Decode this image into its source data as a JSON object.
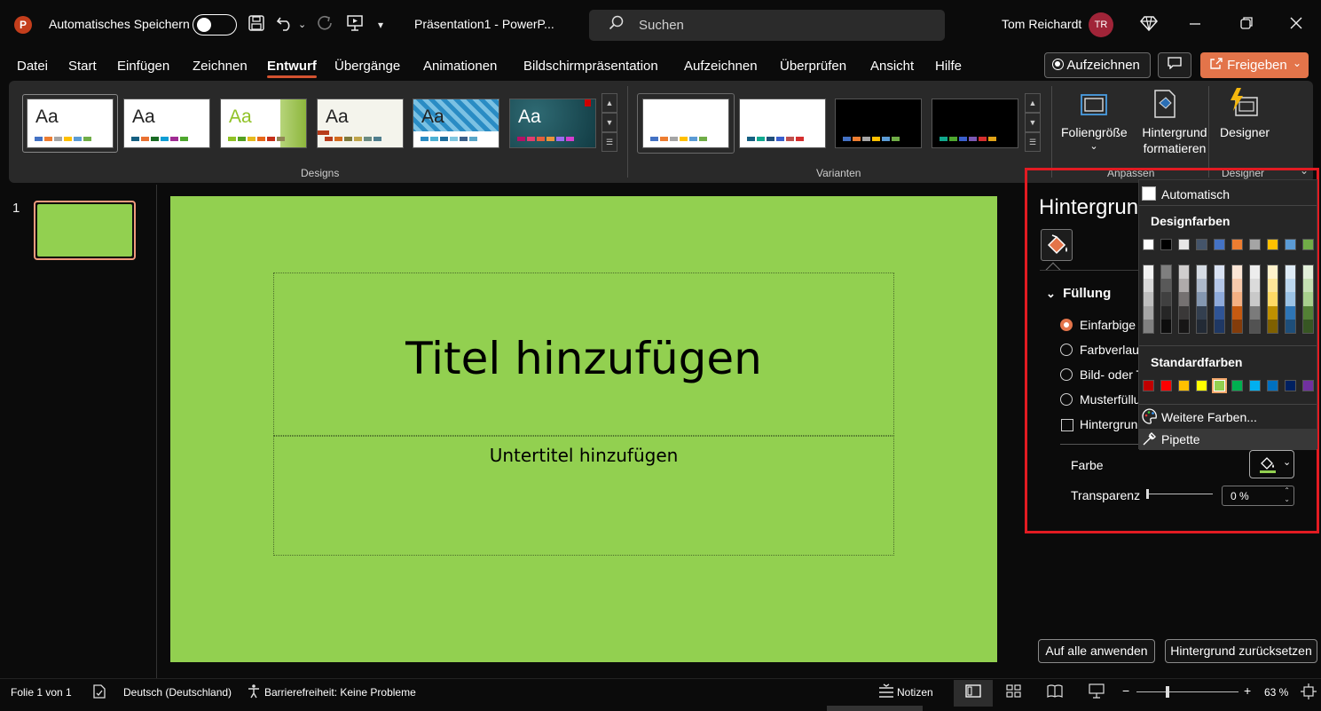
{
  "titlebar": {
    "app_icon": "P",
    "autosave_label": "Automatisches Speichern",
    "doc_title": "Präsentation1  -  PowerP...",
    "search_placeholder": "Suchen",
    "user_name": "Tom Reichardt",
    "user_initials": "TR"
  },
  "menu": {
    "items": [
      "Datei",
      "Start",
      "Einfügen",
      "Zeichnen",
      "Entwurf",
      "Übergänge",
      "Animationen",
      "Bildschirmpräsentation",
      "Aufzeichnen",
      "Überprüfen",
      "Ansicht",
      "Hilfe"
    ],
    "active": "Entwurf",
    "record_label": "Aufzeichnen",
    "share_label": "Freigeben"
  },
  "ribbon": {
    "designs_label": "Designs",
    "variants_label": "Varianten",
    "theme_sample": "Aa",
    "customize_label": "Anpassen",
    "designer_group_label": "Designer",
    "slide_size_label": "Foliengröße",
    "format_bg_label_1": "Hintergrund",
    "format_bg_label_2": "formatieren",
    "designer_label": "Designer"
  },
  "slides_pane": {
    "slide_number": "1"
  },
  "slide": {
    "title_placeholder": "Titel hinzufügen",
    "subtitle_placeholder": "Untertitel hinzufügen",
    "background_color": "#92d050"
  },
  "format_pane": {
    "title": "Hintergrund formatieren",
    "section": "Füllung",
    "fill_options": [
      "Einfarbige Füllung",
      "Farbverlauf",
      "Bild- oder Texturfüllung",
      "Musterfüllung"
    ],
    "selected_fill": "Einfarbige Füllung",
    "hide_graphics_label": "Hintergrundgrafiken ausblenden",
    "color_label": "Farbe",
    "transparency_label": "Transparenz",
    "transparency_value": "0 %",
    "apply_all_label": "Auf alle anwenden",
    "reset_label": "Hintergrund zurücksetzen"
  },
  "color_picker": {
    "automatic_label": "Automatisch",
    "theme_colors_label": "Designfarben",
    "standard_colors_label": "Standardfarben",
    "more_colors_label": "Weitere Farben...",
    "eyedropper_label": "Pipette",
    "theme_colors": [
      "#ffffff",
      "#000000",
      "#e7e6e6",
      "#44546a",
      "#4472c4",
      "#ed7d31",
      "#a5a5a5",
      "#ffc000",
      "#5b9bd5",
      "#70ad47"
    ],
    "theme_shades": [
      [
        "#f2f2f2",
        "#d9d9d9",
        "#bfbfbf",
        "#a6a6a6",
        "#808080"
      ],
      [
        "#7f7f7f",
        "#595959",
        "#404040",
        "#262626",
        "#0d0d0d"
      ],
      [
        "#d0cece",
        "#afabab",
        "#757171",
        "#3a3838",
        "#171616"
      ],
      [
        "#d6dce4",
        "#adb9ca",
        "#8497b0",
        "#333f4f",
        "#222a35"
      ],
      [
        "#d9e2f3",
        "#b4c6e7",
        "#8eaadb",
        "#2f5496",
        "#1f3864"
      ],
      [
        "#fbe5d5",
        "#f7caac",
        "#f4b083",
        "#c55a11",
        "#833c0b"
      ],
      [
        "#ededed",
        "#dbdbdb",
        "#c9c9c9",
        "#7b7b7b",
        "#525252"
      ],
      [
        "#fff2cc",
        "#fee599",
        "#ffd965",
        "#bf9000",
        "#7f6000"
      ],
      [
        "#deebf6",
        "#bdd7ee",
        "#9cc3e5",
        "#2e75b5",
        "#1e4e79"
      ],
      [
        "#e2efd9",
        "#c5e0b3",
        "#a8d08d",
        "#538135",
        "#375623"
      ]
    ],
    "standard_colors": [
      "#c00000",
      "#ff0000",
      "#ffc000",
      "#ffff00",
      "#92d050",
      "#00b050",
      "#00b0f0",
      "#0070c0",
      "#002060",
      "#7030a0"
    ],
    "selected_standard_index": 4
  },
  "statusbar": {
    "slide_info": "Folie 1 von 1",
    "language": "Deutsch (Deutschland)",
    "accessibility": "Barrierefreiheit: Keine Probleme",
    "notes_label": "Notizen",
    "zoom": "63 %"
  }
}
